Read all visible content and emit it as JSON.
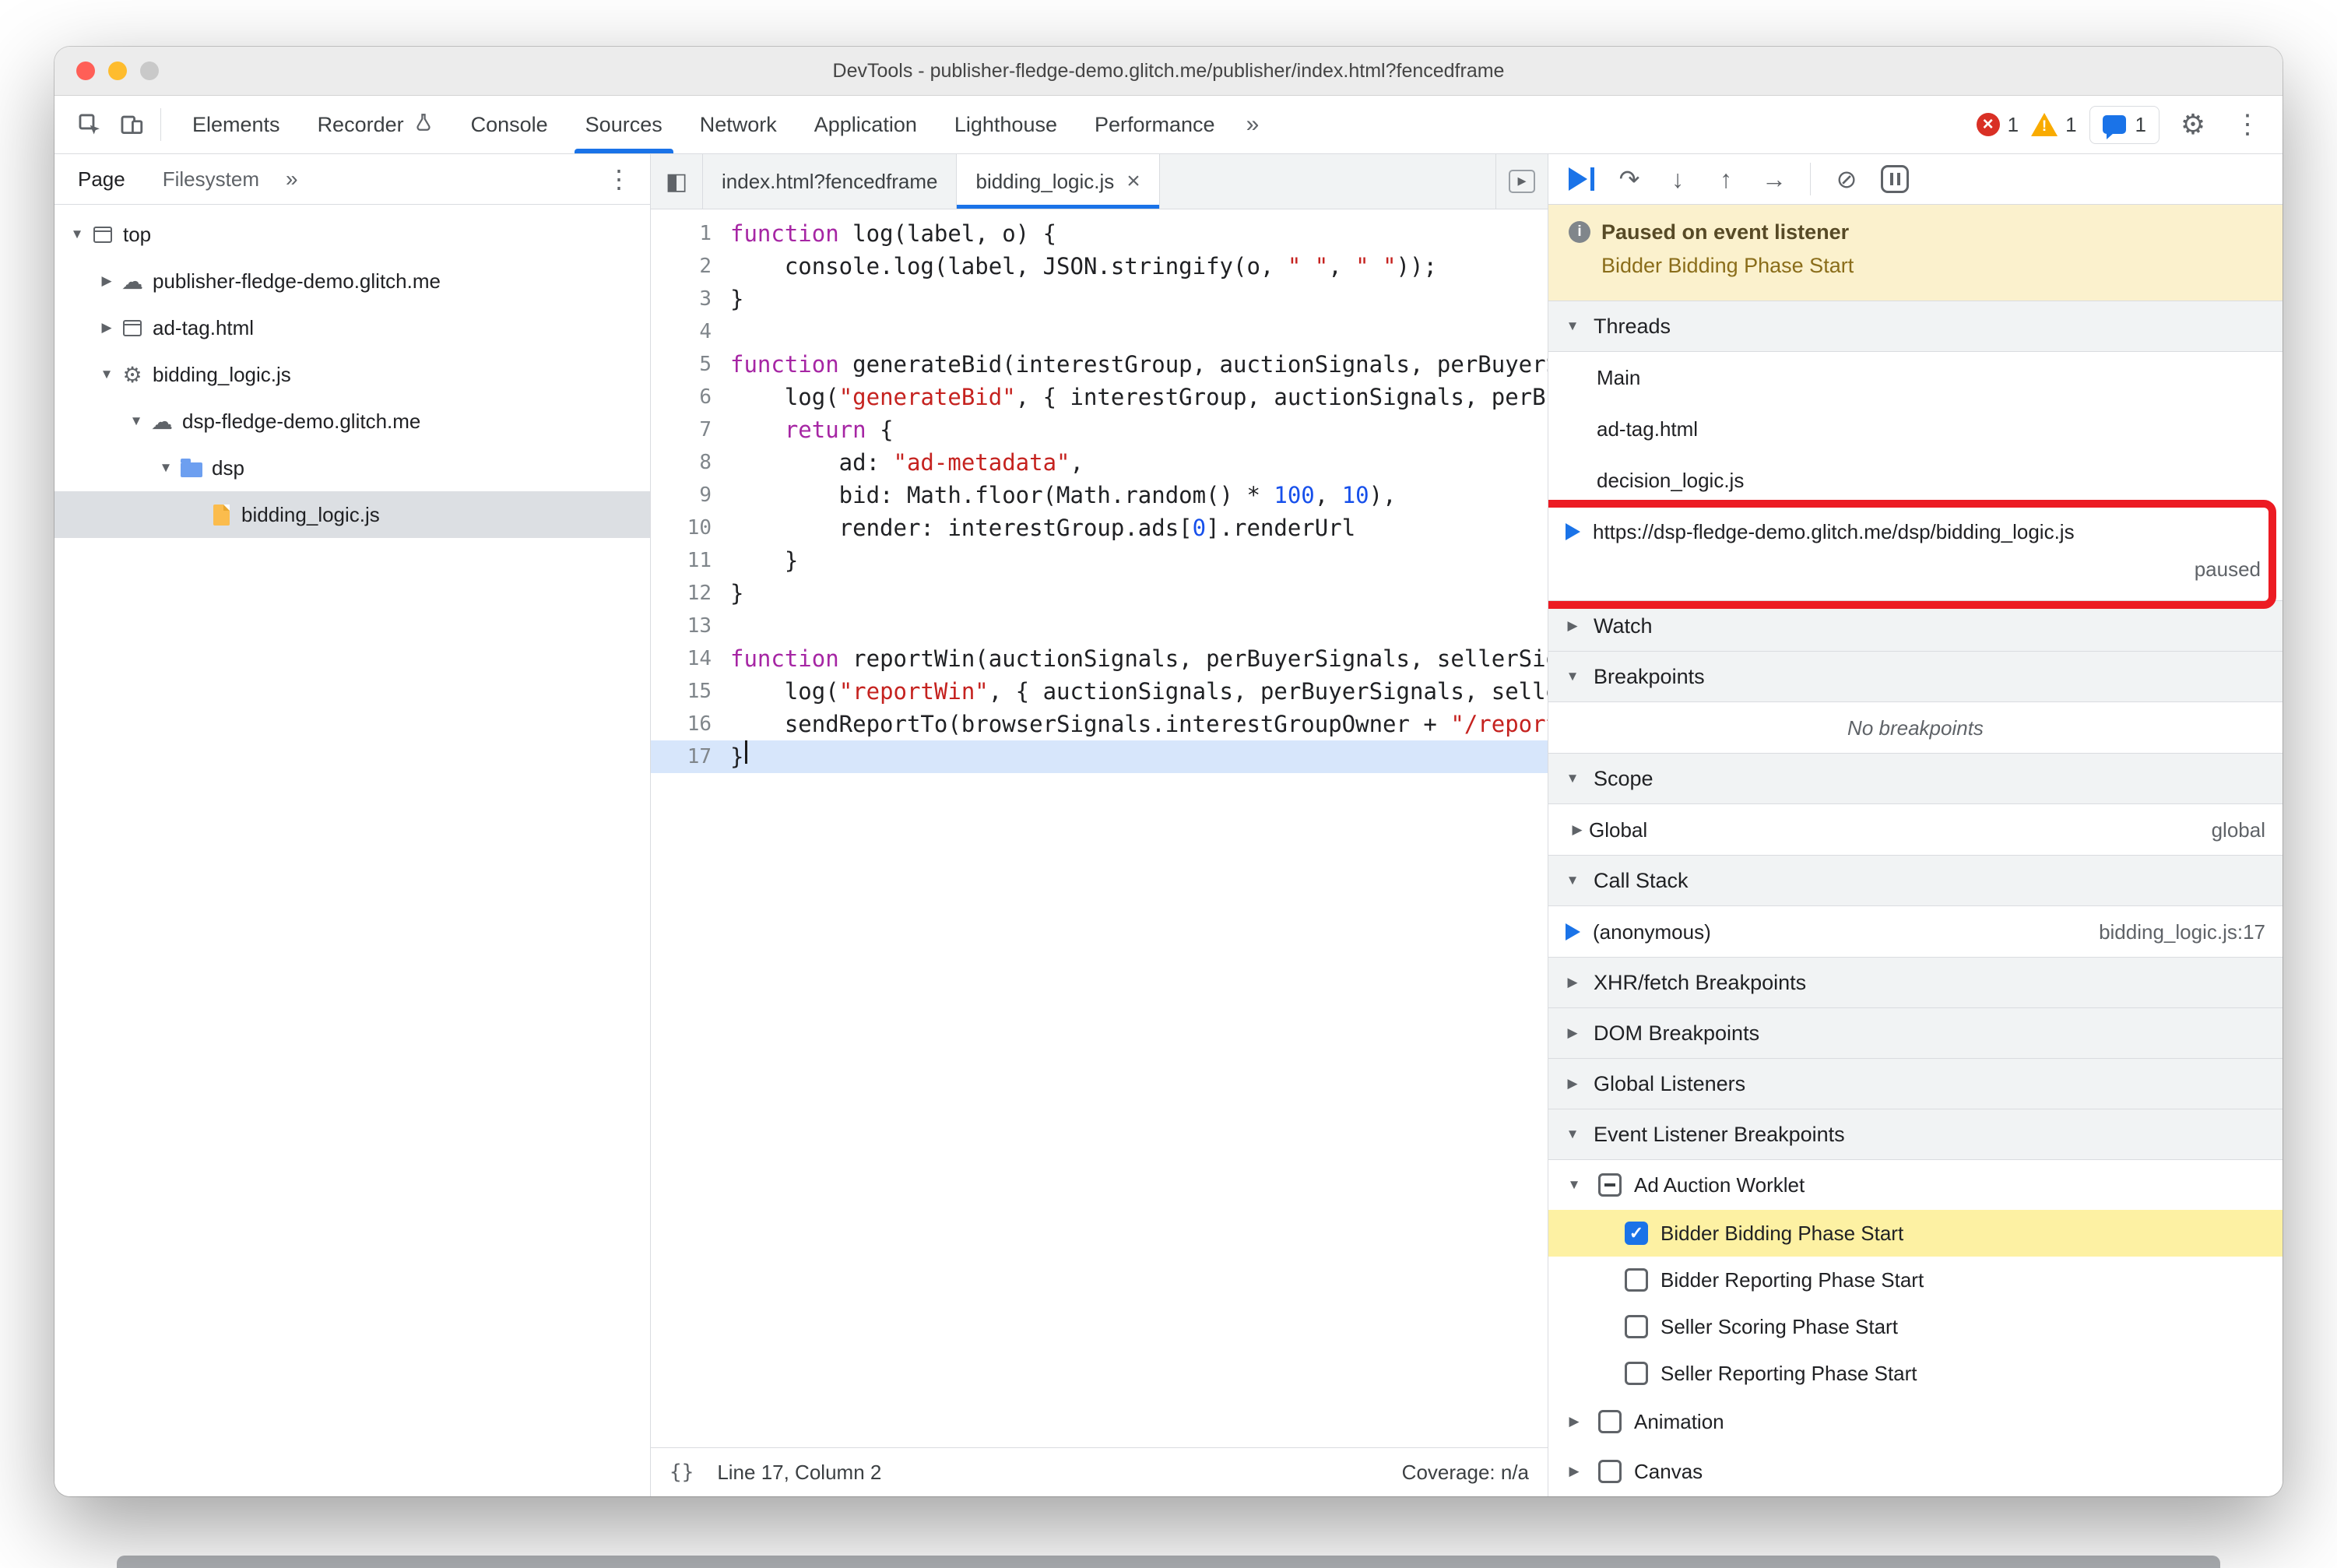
{
  "window": {
    "title": "DevTools - publisher-fledge-demo.glitch.me/publisher/index.html?fencedframe"
  },
  "toolbar": {
    "tabs": [
      {
        "label": "Elements"
      },
      {
        "label": "Recorder",
        "flask": true
      },
      {
        "label": "Console"
      },
      {
        "label": "Sources",
        "selected": true
      },
      {
        "label": "Network"
      },
      {
        "label": "Application"
      },
      {
        "label": "Lighthouse"
      },
      {
        "label": "Performance"
      }
    ],
    "errors": "1",
    "warnings": "1",
    "issues": "1"
  },
  "left_panel": {
    "tabs": [
      "Page",
      "Filesystem"
    ],
    "tree": [
      {
        "label": "top",
        "icon": "frame",
        "twisty": "open",
        "level": 0
      },
      {
        "label": "publisher-fledge-demo.glitch.me",
        "icon": "cloud",
        "twisty": "closed",
        "level": 1
      },
      {
        "label": "ad-tag.html",
        "icon": "frame",
        "twisty": "closed",
        "level": 1
      },
      {
        "label": "bidding_logic.js",
        "icon": "gear",
        "twisty": "open",
        "level": 1
      },
      {
        "label": "dsp-fledge-demo.glitch.me",
        "icon": "cloud",
        "twisty": "open",
        "level": 2
      },
      {
        "label": "dsp",
        "icon": "folder",
        "twisty": "open",
        "level": 3
      },
      {
        "label": "bidding_logic.js",
        "icon": "file",
        "twisty": "none",
        "level": 4,
        "selected": true
      }
    ]
  },
  "editor": {
    "tabs": [
      {
        "label": "index.html?fencedframe"
      },
      {
        "label": "bidding_logic.js",
        "selected": true,
        "closable": true
      }
    ],
    "code": [
      {
        "n": 1,
        "tokens": [
          {
            "s": "k",
            "t": "function"
          },
          {
            "s": "p",
            "t": " log(label, o) {"
          }
        ]
      },
      {
        "n": 2,
        "tokens": [
          {
            "s": "p",
            "t": "    console.log(label, JSON.stringify(o, "
          },
          {
            "s": "s",
            "t": "\" \""
          },
          {
            "s": "p",
            "t": ", "
          },
          {
            "s": "s",
            "t": "\" \""
          },
          {
            "s": "p",
            "t": "));"
          }
        ]
      },
      {
        "n": 3,
        "tokens": [
          {
            "s": "p",
            "t": "}"
          }
        ]
      },
      {
        "n": 4,
        "tokens": []
      },
      {
        "n": 5,
        "tokens": [
          {
            "s": "k",
            "t": "function"
          },
          {
            "s": "p",
            "t": " generateBid(interestGroup, auctionSignals, perBuyerSignals, trustedBiddingSignals, browserSignals) {"
          }
        ]
      },
      {
        "n": 6,
        "tokens": [
          {
            "s": "p",
            "t": "    log("
          },
          {
            "s": "s",
            "t": "\"generateBid\""
          },
          {
            "s": "p",
            "t": ", { interestGroup, auctionSignals, perBuyerSignals, trustedBiddingSignals, browserSignals });"
          }
        ]
      },
      {
        "n": 7,
        "tokens": [
          {
            "s": "p",
            "t": "    "
          },
          {
            "s": "k",
            "t": "return"
          },
          {
            "s": "p",
            "t": " {"
          }
        ]
      },
      {
        "n": 8,
        "tokens": [
          {
            "s": "p",
            "t": "        ad: "
          },
          {
            "s": "s",
            "t": "\"ad-metadata\""
          },
          {
            "s": "p",
            "t": ","
          }
        ]
      },
      {
        "n": 9,
        "tokens": [
          {
            "s": "p",
            "t": "        bid: Math.floor(Math.random() * "
          },
          {
            "s": "n",
            "t": "100"
          },
          {
            "s": "p",
            "t": ", "
          },
          {
            "s": "n",
            "t": "10"
          },
          {
            "s": "p",
            "t": "),"
          }
        ]
      },
      {
        "n": 10,
        "tokens": [
          {
            "s": "p",
            "t": "        render: interestGroup.ads["
          },
          {
            "s": "n",
            "t": "0"
          },
          {
            "s": "p",
            "t": "].renderUrl"
          }
        ]
      },
      {
        "n": 11,
        "tokens": [
          {
            "s": "p",
            "t": "    }"
          }
        ]
      },
      {
        "n": 12,
        "tokens": [
          {
            "s": "p",
            "t": "}"
          }
        ]
      },
      {
        "n": 13,
        "tokens": []
      },
      {
        "n": 14,
        "tokens": [
          {
            "s": "k",
            "t": "function"
          },
          {
            "s": "p",
            "t": " reportWin(auctionSignals, perBuyerSignals, sellerSignals, browserSignals) {"
          }
        ]
      },
      {
        "n": 15,
        "tokens": [
          {
            "s": "p",
            "t": "    log("
          },
          {
            "s": "s",
            "t": "\"reportWin\""
          },
          {
            "s": "p",
            "t": ", { auctionSignals, perBuyerSignals, sellerSignals, browserSignals });"
          }
        ]
      },
      {
        "n": 16,
        "tokens": [
          {
            "s": "p",
            "t": "    sendReportTo(browserSignals.interestGroupOwner + "
          },
          {
            "s": "s",
            "t": "\"/report_win\""
          },
          {
            "s": "p",
            "t": ");"
          }
        ]
      },
      {
        "n": 17,
        "tokens": [
          {
            "s": "p",
            "t": "}"
          }
        ],
        "exec": true
      }
    ],
    "status": {
      "braces": "{}",
      "position": "Line 17, Column 2",
      "coverage": "Coverage: n/a"
    }
  },
  "debugger": {
    "paused": {
      "title": "Paused on event listener",
      "reason": "Bidder Bidding Phase Start"
    },
    "sections": {
      "threads": "Threads",
      "watch": "Watch",
      "breakpoints": "Breakpoints",
      "scope": "Scope",
      "call_stack": "Call Stack",
      "xhr": "XHR/fetch Breakpoints",
      "dom": "DOM Breakpoints",
      "global_listeners": "Global Listeners",
      "event_listener_breakpoints": "Event Listener Breakpoints"
    },
    "threads": {
      "items": [
        {
          "label": "Main"
        },
        {
          "label": "ad-tag.html"
        },
        {
          "label": "decision_logic.js"
        },
        {
          "label": "https://dsp-fledge-demo.glitch.me/dsp/bidding_logic.js",
          "active": true,
          "status": "paused"
        }
      ]
    },
    "breakpoints_empty": "No breakpoints",
    "scope_items": [
      {
        "label": "Global",
        "value": "global",
        "twisty": "closed"
      }
    ],
    "call_stack_items": [
      {
        "label": "(anonymous)",
        "location": "bidding_logic.js:17",
        "active": true
      }
    ],
    "event_listener_breakpoints": {
      "groups": [
        {
          "label": "Ad Auction Worklet",
          "twisty": "open",
          "checkbox": "indeterminate",
          "children": [
            {
              "label": "Bidder Bidding Phase Start",
              "checkbox": "checked",
              "highlighted": true
            },
            {
              "label": "Bidder Reporting Phase Start",
              "checkbox": "unchecked"
            },
            {
              "label": "Seller Scoring Phase Start",
              "checkbox": "unchecked"
            },
            {
              "label": "Seller Reporting Phase Start",
              "checkbox": "unchecked"
            }
          ]
        },
        {
          "label": "Animation",
          "twisty": "closed",
          "checkbox": "unchecked",
          "children": []
        },
        {
          "label": "Canvas",
          "twisty": "closed",
          "checkbox": "unchecked",
          "children": []
        }
      ]
    }
  },
  "icons": {
    "more": "»",
    "kebab": "⋮",
    "gear": "⚙",
    "close": "×",
    "twisty_open": "▼",
    "twisty_closed": "▶",
    "cloud": "☁",
    "check": "✓",
    "step_over": "↷",
    "step_into": "↓",
    "step_out": "↑",
    "step": "→",
    "deactivate": "⊘",
    "info": "i",
    "error_mark": "×",
    "warning_mark": "!",
    "nav_left": "◧",
    "nav_right": "▸"
  },
  "colors": {
    "accent": "#1a73e8",
    "annotation_red": "#ec1b23",
    "paused_banner_bg": "#fbf1cd",
    "highlight_yellow": "#fdf1a3",
    "exec_line_blue": "#d7e6fb",
    "error_red": "#d93025",
    "warning_orange": "#f9ab00"
  }
}
